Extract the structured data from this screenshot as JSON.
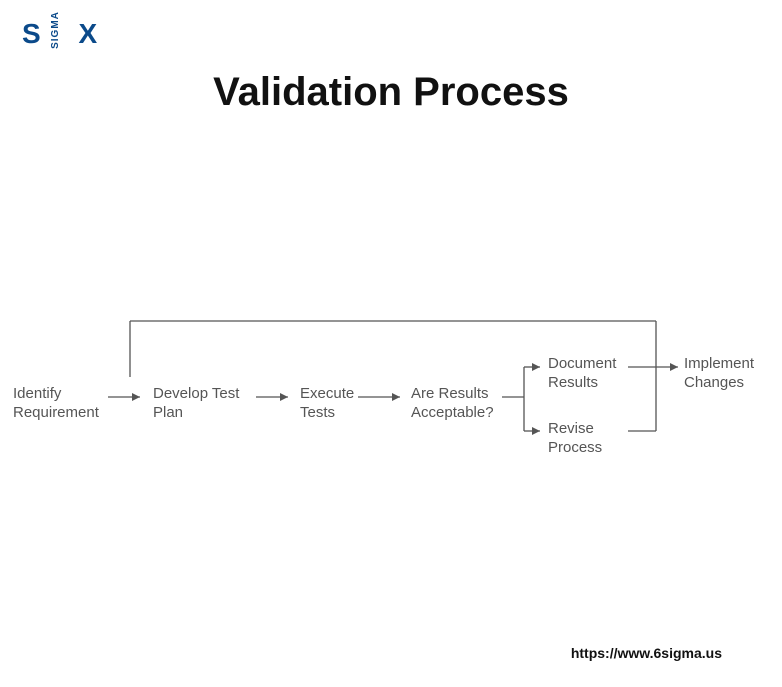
{
  "logo": {
    "main": "S X",
    "sigma": "SIGMA"
  },
  "title": "Validation Process",
  "nodes": {
    "identify": "Identify\nRequirement",
    "develop": "Develop Test\nPlan",
    "execute": "Execute\nTests",
    "acceptable": "Are Results\nAcceptable?",
    "document": "Document\nResults",
    "revise": "Revise\nProcess",
    "implement": "Implement\nChanges"
  },
  "footer": "https://www.6sigma.us"
}
